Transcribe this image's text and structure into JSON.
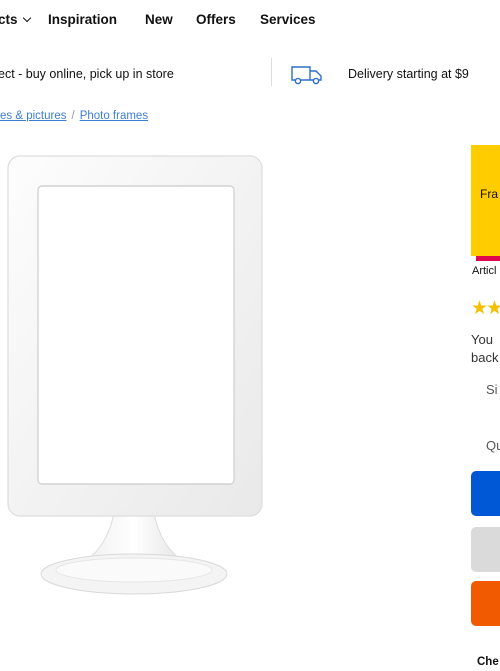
{
  "nav": {
    "items": [
      {
        "label": "cts",
        "has_dropdown": true
      },
      {
        "label": "Inspiration"
      },
      {
        "label": "New"
      },
      {
        "label": "Offers"
      },
      {
        "label": "Services"
      }
    ]
  },
  "promo_bar": {
    "click_collect": "ect - buy online, pick up in store",
    "delivery": "Delivery starting at $9",
    "delivery_icon": "truck-icon"
  },
  "breadcrumb": {
    "items": [
      "es & pictures",
      "Photo frames"
    ],
    "separator": "/"
  },
  "product": {
    "image_icon": "photo-frame-image",
    "badge_label": "Fra",
    "badge_color": "#ffcc00",
    "article_label": "Articl",
    "rating_icon": "star-icon",
    "description_lines": [
      "You",
      "back"
    ],
    "size_label": "Si",
    "quantity_label": "Qu",
    "check_label": "Che"
  },
  "colors": {
    "accent_blue": "#0058d6",
    "link": "#3d7ed7",
    "sale_yellow": "#ffcc00",
    "sale_red": "#e00751",
    "orange": "#f15a01"
  }
}
